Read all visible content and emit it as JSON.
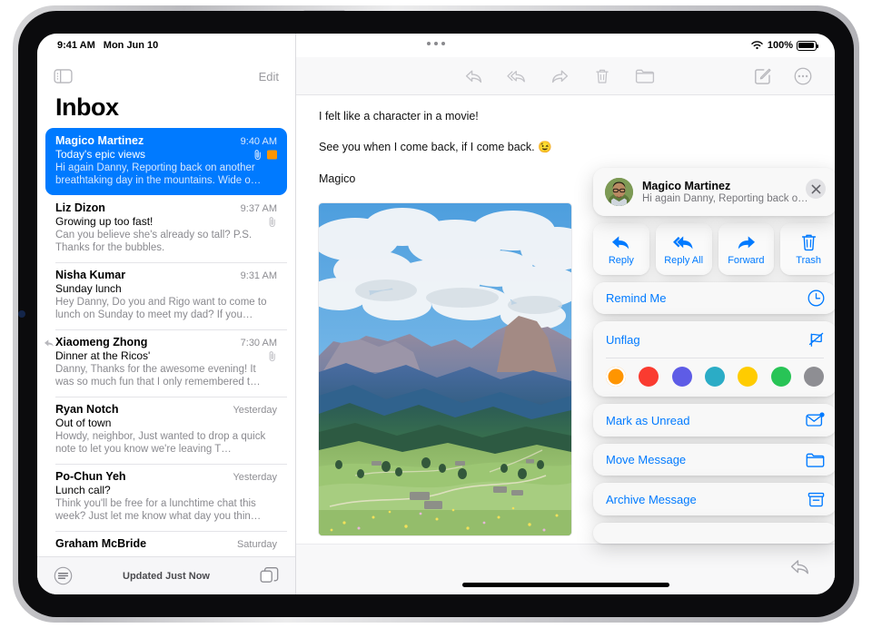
{
  "status_bar": {
    "time": "9:41 AM",
    "date": "Mon Jun 10",
    "wifi_icon": "wifi-icon",
    "battery_percent": "100%",
    "battery_icon": "battery-full-icon",
    "multitask_handle_icon": "multitasking-handle-icon"
  },
  "sidebar": {
    "toggle_icon": "sidebar-toggle-icon",
    "edit_label": "Edit",
    "title": "Inbox",
    "updated_status": "Updated Just Now",
    "filter_icon": "filter-icon",
    "new_mailbox_icon": "mailboxes-icon",
    "messages": [
      {
        "sender": "Magico Martinez",
        "time": "9:40 AM",
        "subject": "Today's epic views",
        "preview": "Hi again Danny, Reporting back on another breathtaking day in the mountains. Wide o…",
        "has_attachment": true,
        "flagged": true,
        "replied": false,
        "selected": true
      },
      {
        "sender": "Liz Dizon",
        "time": "9:37 AM",
        "subject": "Growing up too fast!",
        "preview": "Can you believe she's already so tall? P.S. Thanks for the bubbles.",
        "has_attachment": true,
        "flagged": false,
        "replied": false,
        "selected": false
      },
      {
        "sender": "Nisha Kumar",
        "time": "9:31 AM",
        "subject": "Sunday lunch",
        "preview": "Hey Danny, Do you and Rigo want to come to lunch on Sunday to meet my dad? If you…",
        "has_attachment": false,
        "flagged": false,
        "replied": false,
        "selected": false
      },
      {
        "sender": "Xiaomeng Zhong",
        "time": "7:30 AM",
        "subject": "Dinner at the Ricos'",
        "preview": "Danny, Thanks for the awesome evening! It was so much fun that I only remembered t…",
        "has_attachment": true,
        "flagged": false,
        "replied": true,
        "selected": false
      },
      {
        "sender": "Ryan Notch",
        "time": "Yesterday",
        "subject": "Out of town",
        "preview": "Howdy, neighbor, Just wanted to drop a quick note to let you know we're leaving T…",
        "has_attachment": false,
        "flagged": false,
        "replied": false,
        "selected": false
      },
      {
        "sender": "Po-Chun Yeh",
        "time": "Yesterday",
        "subject": "Lunch call?",
        "preview": "Think you'll be free for a lunchtime chat this week? Just let me know what day you thin…",
        "has_attachment": false,
        "flagged": false,
        "replied": false,
        "selected": false
      },
      {
        "sender": "Graham McBride",
        "time": "Saturday",
        "subject": "",
        "preview": "",
        "has_attachment": false,
        "flagged": false,
        "replied": false,
        "selected": false
      }
    ]
  },
  "detail": {
    "toolbar": [
      {
        "name": "reply-toolbar-icon",
        "label": "Reply",
        "disabled": true
      },
      {
        "name": "reply-all-toolbar-icon",
        "label": "Reply All",
        "disabled": true
      },
      {
        "name": "forward-toolbar-icon",
        "label": "Forward",
        "disabled": true
      },
      {
        "name": "trash-toolbar-icon",
        "label": "Trash",
        "disabled": true
      },
      {
        "name": "move-folder-toolbar-icon",
        "label": "Move to Folder",
        "disabled": true
      }
    ],
    "compose_icon": "compose-icon",
    "more_icon": "more-ellipsis-icon",
    "body_lines": [
      "I felt like a character in a movie!",
      "See you when I come back, if I come back. 😉",
      "Magico"
    ],
    "photo_alt": "mountain-landscape-photo",
    "reply_fab_icon": "reply-icon"
  },
  "popup": {
    "sender": "Magico Martinez",
    "preview": "Hi again Danny, Reporting back o…",
    "close_icon": "close-icon",
    "avatar_icon": "avatar",
    "actions": [
      {
        "label": "Reply",
        "icon": "reply-icon"
      },
      {
        "label": "Reply All",
        "icon": "reply-all-icon"
      },
      {
        "label": "Forward",
        "icon": "forward-icon"
      },
      {
        "label": "Trash",
        "icon": "trash-icon"
      }
    ],
    "remind_me": {
      "label": "Remind Me",
      "icon": "clock-icon"
    },
    "flag": {
      "label": "Unflag",
      "icon": "flag-slash-icon"
    },
    "flag_colors": [
      {
        "name": "orange",
        "hex": "#ff9500",
        "selected": true
      },
      {
        "name": "red",
        "hex": "#fa3b30",
        "selected": false
      },
      {
        "name": "purple",
        "hex": "#5e5ce6",
        "selected": false
      },
      {
        "name": "teal",
        "hex": "#2bacc6",
        "selected": false
      },
      {
        "name": "yellow",
        "hex": "#ffcc00",
        "selected": false
      },
      {
        "name": "green",
        "hex": "#28c456",
        "selected": false
      },
      {
        "name": "gray",
        "hex": "#8e8e93",
        "selected": false
      }
    ],
    "mark_unread": {
      "label": "Mark as Unread",
      "icon": "envelope-badge-icon"
    },
    "move_message": {
      "label": "Move Message",
      "icon": "folder-icon"
    },
    "archive_message": {
      "label": "Archive Message",
      "icon": "archive-box-icon"
    }
  },
  "colors": {
    "accent": "#007aff",
    "flag_orange": "#ff9500",
    "muted_text": "#8e8e93"
  }
}
